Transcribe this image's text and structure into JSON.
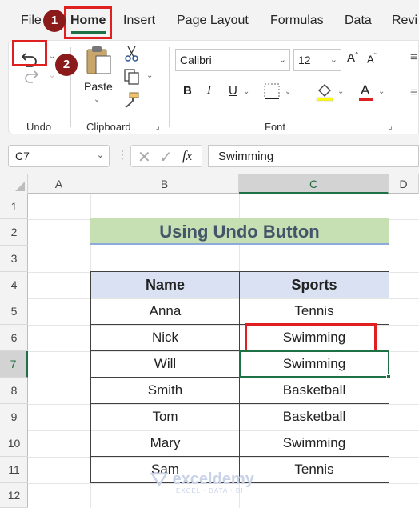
{
  "menu": {
    "tabs": [
      "File",
      "Home",
      "Insert",
      "Page Layout",
      "Formulas",
      "Data",
      "Revi"
    ],
    "active_tab": "Home"
  },
  "callouts": [
    "1",
    "2"
  ],
  "ribbon": {
    "undo_group_label": "Undo",
    "clipboard": {
      "paste_label": "Paste",
      "group_label": "Clipboard"
    },
    "font": {
      "family": "Calibri",
      "size": "12",
      "group_label": "Font",
      "bold": "B",
      "italic": "I",
      "underline": "U"
    }
  },
  "formula_bar": {
    "name_box": "C7",
    "fx": "fx",
    "value": "Swimming"
  },
  "columns": [
    "A",
    "B",
    "C",
    "D"
  ],
  "rows": [
    "1",
    "2",
    "3",
    "4",
    "5",
    "6",
    "7",
    "8",
    "9",
    "10",
    "11",
    "12"
  ],
  "sheet": {
    "title": "Using Undo Button",
    "headers": [
      "Name",
      "Sports"
    ],
    "records": [
      [
        "Anna",
        "Tennis"
      ],
      [
        "Nick",
        "Swimming"
      ],
      [
        "Will",
        "Swimming"
      ],
      [
        "Smith",
        "Basketball"
      ],
      [
        "Tom",
        "Basketball"
      ],
      [
        "Mary",
        "Swimming"
      ],
      [
        "Sam",
        "Tennis"
      ]
    ]
  },
  "watermark": {
    "name": "exceldemy",
    "tagline": "EXCEL · DATA · BI"
  },
  "colors": {
    "accent": "#1e7145",
    "highlight": "#e02020",
    "title_fill": "#c6e0b4",
    "header_fill": "#d9e1f2",
    "callout": "#8b1a1a"
  }
}
